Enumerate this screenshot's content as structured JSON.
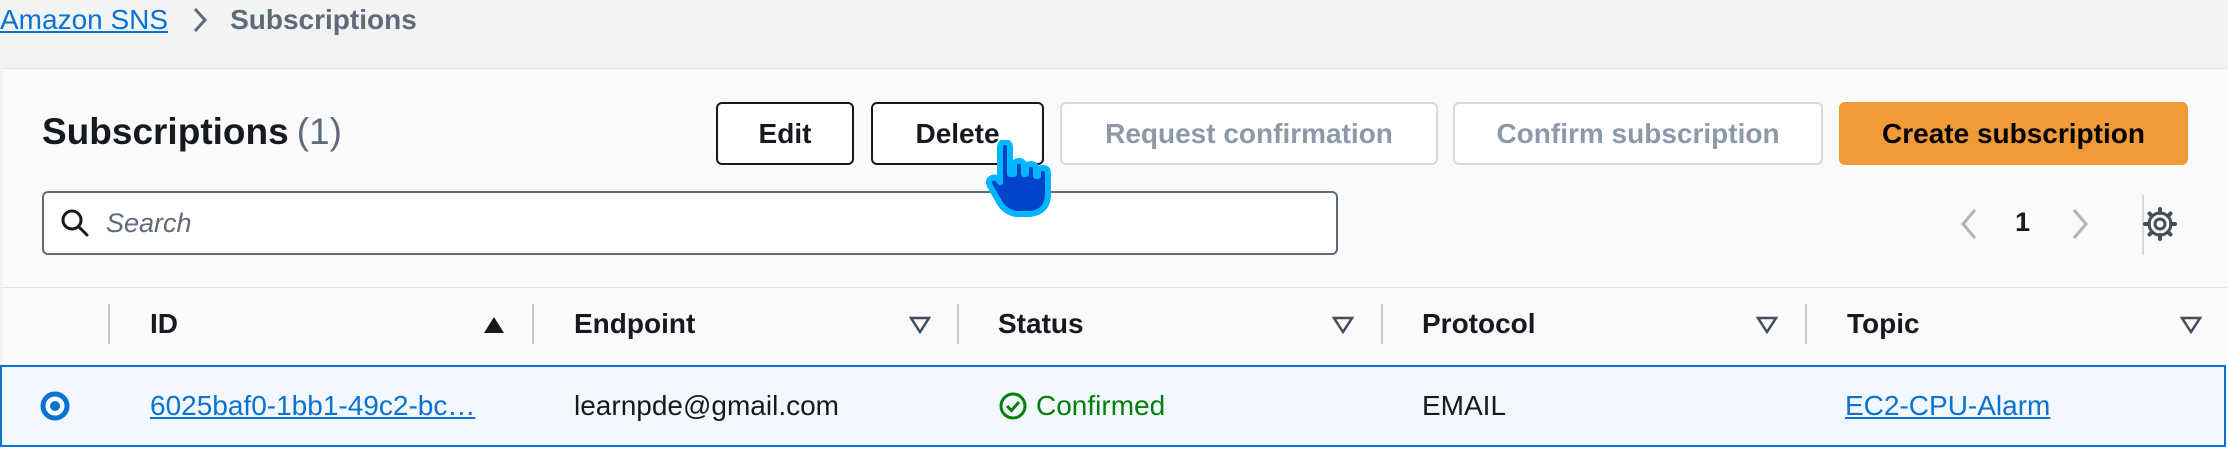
{
  "breadcrumb": {
    "root": "Amazon SNS",
    "current": "Subscriptions"
  },
  "panel": {
    "title": "Subscriptions",
    "count": "(1)"
  },
  "actions": {
    "edit": "Edit",
    "delete": "Delete",
    "request_confirmation": "Request confirmation",
    "confirm_subscription": "Confirm subscription",
    "create_subscription": "Create subscription"
  },
  "search": {
    "placeholder": "Search",
    "value": ""
  },
  "pagination": {
    "current_page": "1"
  },
  "table": {
    "columns": [
      "ID",
      "Endpoint",
      "Status",
      "Protocol",
      "Topic"
    ],
    "rows": [
      {
        "id": "6025baf0-1bb1-49c2-bc…",
        "endpoint": "learnpde@gmail.com",
        "status": "Confirmed",
        "protocol": "EMAIL",
        "topic": "EC2-CPU-Alarm"
      }
    ]
  },
  "colors": {
    "accent": "#0972d3",
    "primary_button": "#f19a38",
    "success": "#037f0c"
  }
}
